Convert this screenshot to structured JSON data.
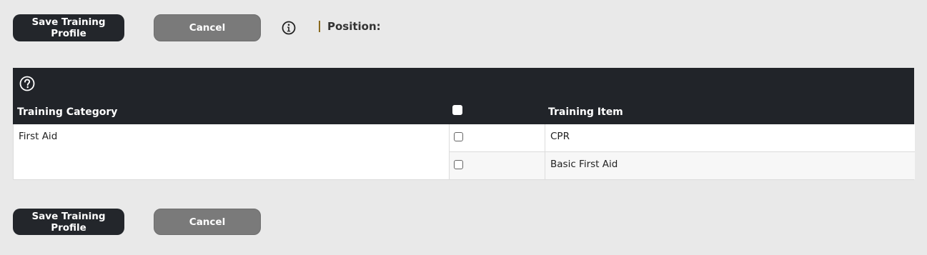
{
  "toolbar_top": {
    "save_label": "Save Training Profile",
    "cancel_label": "Cancel",
    "position_label": "Position:"
  },
  "table": {
    "headers": {
      "category": "Training Category",
      "item": "Training Item"
    },
    "rows": [
      {
        "category": "First Aid",
        "items": [
          {
            "label": "CPR",
            "checked": false
          },
          {
            "label": "Basic First Aid",
            "checked": false
          }
        ]
      }
    ]
  },
  "toolbar_bottom": {
    "save_label": "Save Training Profile",
    "cancel_label": "Cancel"
  }
}
